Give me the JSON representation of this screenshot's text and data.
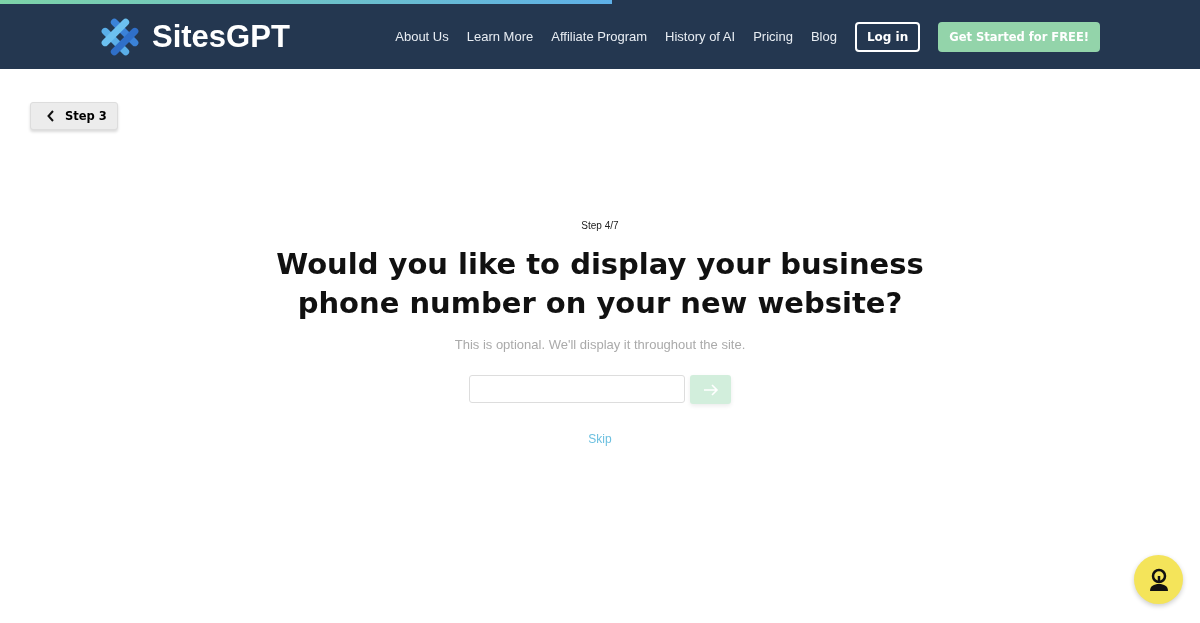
{
  "progress": {
    "level": 0.51
  },
  "header": {
    "brand": "SitesGPT",
    "nav": [
      "About Us",
      "Learn More",
      "Affiliate Program",
      "History of AI",
      "Pricing",
      "Blog"
    ],
    "login": "Log in",
    "cta": "Get Started for FREE!"
  },
  "back_button": {
    "label": "Step 3"
  },
  "step": "Step 4/7",
  "heading": "Would you like to display your business phone number on your new website?",
  "subtitle": "This is optional. We'll display it throughout the site.",
  "phone_field": {
    "submit_disabled": true
  },
  "skip": "Skip"
}
